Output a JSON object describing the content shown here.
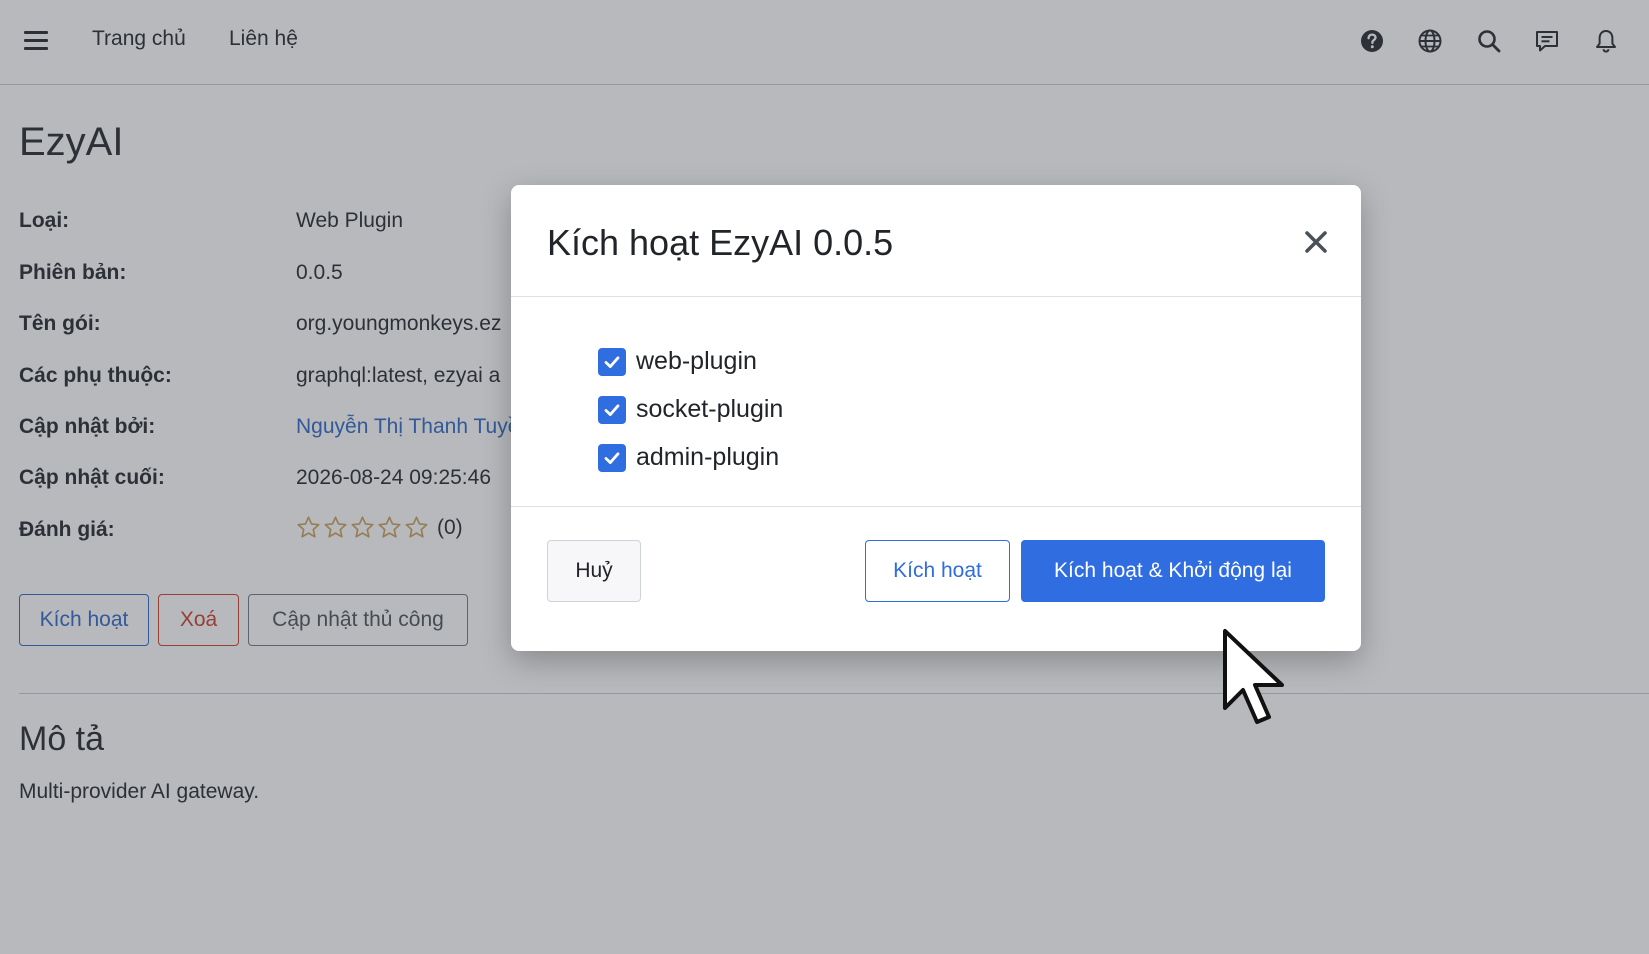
{
  "nav": {
    "links": [
      "Trang chủ",
      "Liên hệ"
    ],
    "icons": [
      "help-icon",
      "globe-icon",
      "search-icon",
      "chat-icon",
      "bell-icon"
    ]
  },
  "plugin": {
    "title": "EzyAI",
    "fields": [
      {
        "label": "Loại:",
        "value": "Web Plugin"
      },
      {
        "label": "Phiên bản:",
        "value": "0.0.5"
      },
      {
        "label": "Tên gói:",
        "value": "org.youngmonkeys.ez"
      },
      {
        "label": "Các phụ thuộc:",
        "value": "graphql:latest, ezyai a"
      },
      {
        "label": "Cập nhật bởi:",
        "value": "Nguyễn Thị Thanh Tuyề"
      },
      {
        "label": "Cập nhật cuối:",
        "value": "2026-08-24 09:25:46"
      },
      {
        "label": "Đánh giá:",
        "value": "(0)"
      }
    ],
    "rating_stars": 0,
    "rating_max": 5,
    "actions": {
      "activate": "Kích hoạt",
      "delete": "Xoá",
      "manual_update": "Cập nhật thủ công"
    },
    "description_title": "Mô tả",
    "description": "Multi-provider AI gateway."
  },
  "modal": {
    "title": "Kích hoạt EzyAI 0.0.5",
    "options": [
      {
        "label": "web-plugin",
        "checked": true
      },
      {
        "label": "socket-plugin",
        "checked": true
      },
      {
        "label": "admin-plugin",
        "checked": true
      }
    ],
    "cancel_label": "Huỷ",
    "activate_label": "Kích hoạt",
    "activate_restart_label": "Kích hoạt & Khởi động lại"
  },
  "colors": {
    "primary": "#2f6de1",
    "danger": "#c83a2c",
    "link": "#2a64c6",
    "star": "#c9a15a"
  }
}
